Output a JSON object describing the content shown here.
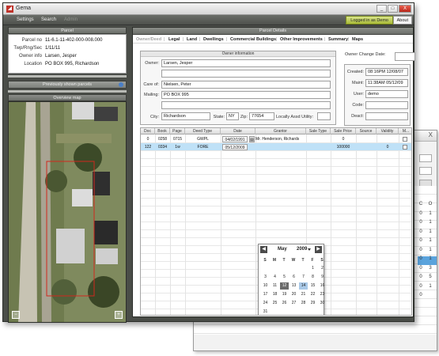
{
  "app": {
    "title": "Gema",
    "icon": "app-logo-icon"
  },
  "window_buttons": [
    "_",
    "□",
    "X"
  ],
  "menu": {
    "items": [
      "Settings",
      "Search",
      "Admin"
    ],
    "logged_in": "Logged in as Demo",
    "about": "About"
  },
  "parcel_panel": {
    "header": "Parcel",
    "rows": [
      {
        "label": "Parcel no",
        "value": "11-6.1-11-402-000-008.000"
      },
      {
        "label": "Twp/Rng/Sec",
        "value": "1/11/11"
      },
      {
        "label": "Owner info",
        "value": "Larsen, Jesper"
      },
      {
        "label": "Location",
        "value": "PO BOX 995, Richardson"
      }
    ],
    "previously_shown": "Previously shown parcels",
    "overview_header": "Overview map"
  },
  "details": {
    "header": "Parcel Details",
    "tabs": [
      "Owner/Deed",
      "Legal",
      "Land",
      "Dwellings",
      "Commercial Buildings",
      "Other Improvements",
      "Summary",
      "Maps"
    ],
    "owner_info": {
      "header": "Owner information",
      "owner_label": "Owner:",
      "owner": "Larsen, Jesper",
      "care_of_label": "Care of:",
      "care_of": "Nielsen, Peter",
      "mailing_label": "Mailing:",
      "mailing": "PO BOX 995",
      "city_label": "City:",
      "city": "Richardson",
      "state_label": "State:",
      "state": "NY",
      "zip_label": "Zip:",
      "zip": "77654",
      "utility_label": "Locally Assd Utility:"
    },
    "owner_change_label": "Owner Change Date:",
    "audit": {
      "created_label": "Created:",
      "created": "08:16PM 12/08/07",
      "maint_label": "Maint:",
      "maint": "11:38AM 05/12/09",
      "user_label": "User:",
      "user": "demo",
      "code_label": "Code:",
      "code": "",
      "deact_label": "Deact:",
      "deact": ""
    },
    "sales_table": {
      "columns": [
        "Doc",
        "Book",
        "Page",
        "Deed Type",
        "Date",
        "Grantor",
        "Sale Type",
        "Sale Price",
        "Source",
        "Validity",
        "M..."
      ],
      "rows": [
        {
          "doc": "0",
          "book": "0258",
          "page": "0715",
          "deed_type": "GWPL",
          "date": "04/02/1991",
          "grantor": "Mr. Henderson, Richards",
          "sale_type": "",
          "sale_price": "0",
          "source": "",
          "validity": "",
          "m": ""
        },
        {
          "doc": "122",
          "book": "0334",
          "page": "1w",
          "deed_type": "FORE",
          "date": "05/12/2009",
          "grantor": "",
          "sale_type": "",
          "sale_price": "100000",
          "source": "",
          "validity": "0",
          "m": ""
        }
      ]
    }
  },
  "datepicker": {
    "month": "May",
    "year": "2009",
    "weekdays": [
      "S",
      "M",
      "T",
      "W",
      "T",
      "F",
      "S"
    ],
    "weeks": [
      [
        "",
        "",
        "",
        "",
        "",
        "1",
        "2"
      ],
      [
        "3",
        "4",
        "5",
        "6",
        "7",
        "8",
        "9"
      ],
      [
        "10",
        "11",
        "12",
        "13",
        "14",
        "15",
        "16"
      ],
      [
        "17",
        "18",
        "19",
        "20",
        "21",
        "22",
        "23"
      ],
      [
        "24",
        "25",
        "26",
        "27",
        "28",
        "29",
        "30"
      ],
      [
        "31",
        "",
        "",
        "",
        "",
        "",
        ""
      ]
    ],
    "selected_day": "12",
    "today_day": "14"
  },
  "background_window": {
    "close": "X",
    "column_values_left": [
      "C",
      "0",
      "0",
      "0",
      "0",
      "0",
      "0",
      "0",
      "0",
      "0",
      "0"
    ],
    "column_values_right": [
      "O",
      "1",
      "1",
      "1",
      "1",
      "1",
      "1",
      "3",
      "5",
      "1"
    ]
  }
}
